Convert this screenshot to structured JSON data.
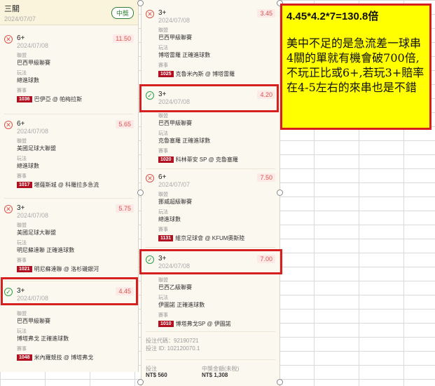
{
  "left_panel": {
    "title": "三關",
    "date": "2024/07/07",
    "badge": "中獎",
    "picks": [
      {
        "type": "6+",
        "date": "2024/07/08",
        "odds": "11.50",
        "status": "lost",
        "league_label": "聯盟",
        "league": "巴西甲級聯賽",
        "play_label": "玩法",
        "play": "總進球數",
        "match_label": "賽事",
        "match_no": "1036",
        "match": "巴伊亞 @ 帕梅拉斯"
      },
      {
        "type": "6+",
        "date": "2024/07/08",
        "odds": "5.65",
        "status": "lost",
        "league_label": "聯盟",
        "league": "美國足球大聯盟",
        "play_label": "玩法",
        "play": "總進球數",
        "match_label": "賽事",
        "match_no": "1017",
        "match": "堪薩斯城 @ 科羅拉多急流"
      },
      {
        "type": "3+",
        "date": "2024/07/08",
        "odds": "5.75",
        "status": "lost",
        "league_label": "聯盟",
        "league": "美國足球大聯盟",
        "play_label": "玩法",
        "play": "明尼蘇達聯 正確進球數",
        "match_label": "賽事",
        "match_no": "1021",
        "match": "明尼蘇達聯 @ 洛杉磯銀河"
      },
      {
        "type": "3+",
        "date": "2024/07/08",
        "odds": "4.45",
        "status": "won",
        "league_label": "聯盟",
        "league": "巴西甲級聯賽",
        "play_label": "玩法",
        "play": "博塔弗戈 正確進球數",
        "match_label": "賽事",
        "match_no": "1048",
        "match": "米內羅競技 @ 博塔弗戈"
      }
    ]
  },
  "mid_panel": {
    "picks": [
      {
        "type": "3+",
        "date": "2024/07/08",
        "odds": "3.45",
        "status": "lost",
        "league_label": "聯盟",
        "league": "巴西甲級聯賽",
        "play_label": "玩法",
        "play": "博塔雷羅 正確進球數",
        "match_label": "賽事",
        "match_no": "1025",
        "match": "克魯米內斯 @ 博塔雷羅"
      },
      {
        "type": "3+",
        "date": "2024/07/08",
        "odds": "4.20",
        "status": "won",
        "league_label": "聯盟",
        "league": "巴西甲級聯賽",
        "play_label": "玩法",
        "play": "克魯塞羅 正確進球數",
        "match_label": "賽事",
        "match_no": "1020",
        "match": "科林蒂安 SP @ 克魯塞羅"
      },
      {
        "type": "6+",
        "date": "2024/07/07",
        "odds": "7.50",
        "status": "lost",
        "league_label": "聯盟",
        "league": "挪威超級聯賽",
        "play_label": "玩法",
        "play": "總進球數",
        "match_label": "賽事",
        "match_no": "1131",
        "match": "維京足球會 @ KFUM奧斯陸"
      },
      {
        "type": "3+",
        "date": "2024/07/08",
        "odds": "7.00",
        "status": "won",
        "league_label": "聯盟",
        "league": "巴西乙級聯賽",
        "play_label": "玩法",
        "play": "伊圖諾 正確進球數",
        "match_label": "賽事",
        "match_no": "1010",
        "match": "博塔弗戈SP @ 伊圖諾"
      }
    ],
    "code_label": "投注代碼：92190721",
    "id_label": "投注 ID: 102120070.1",
    "stake_label": "投注",
    "stake": "NT$ 560",
    "payout_label": "中獎金額(未稅)",
    "payout": "NT$ 1,308"
  },
  "note": {
    "formula": "4.45*4.2*7=130.8倍",
    "text": "美中不足的是急流差一球串4關的單就有機會破700倍,不玩正比或6+,若玩3+賠率在4-5左右的來串也是不錯"
  },
  "colors": {
    "highlight": "#d61f1f",
    "note_bg": "#ffff00",
    "odds": "#d9534f",
    "won": "#2e9d4a"
  }
}
